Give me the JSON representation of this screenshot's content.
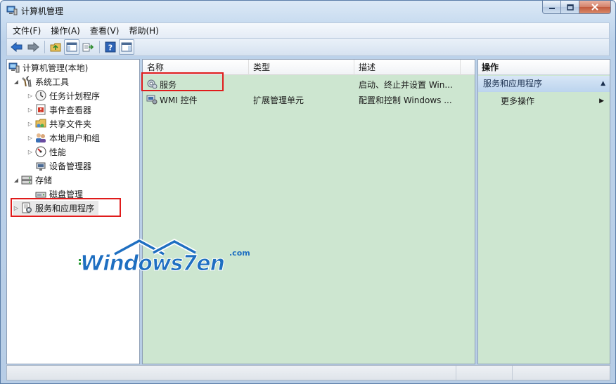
{
  "window": {
    "title": "计算机管理"
  },
  "menu": [
    "文件(F)",
    "操作(A)",
    "查看(V)",
    "帮助(H)"
  ],
  "toolbar": {
    "buttons": [
      "back-arrow-icon",
      "forward-arrow-icon",
      "up-folder-icon",
      "show-hide-tree-icon",
      "export-list-icon",
      "help-icon",
      "show-hide-action-pane-icon"
    ]
  },
  "tree": {
    "root": "计算机管理(本地)",
    "system_tools": "系统工具",
    "task_scheduler": "任务计划程序",
    "event_viewer": "事件查看器",
    "shared_folders": "共享文件夹",
    "local_users": "本地用户和组",
    "performance": "性能",
    "device_manager": "设备管理器",
    "storage": "存储",
    "disk_management": "磁盘管理",
    "services_apps": "服务和应用程序"
  },
  "list": {
    "columns": [
      "名称",
      "类型",
      "描述"
    ],
    "rows": [
      {
        "name": "服务",
        "type": "",
        "desc": "启动、终止并设置 Win..."
      },
      {
        "name": "WMI 控件",
        "type": "扩展管理单元",
        "desc": "配置和控制 Windows ..."
      }
    ]
  },
  "actions": {
    "title": "操作",
    "section": "服务和应用程序",
    "more": "更多操作"
  },
  "watermark": {
    "text": "Windows7en",
    "suffix": ".com"
  },
  "colors": {
    "pane_green": "#cde6d0",
    "highlight_red": "#e01b1b",
    "watermark_blue": "#1f6fc1"
  }
}
